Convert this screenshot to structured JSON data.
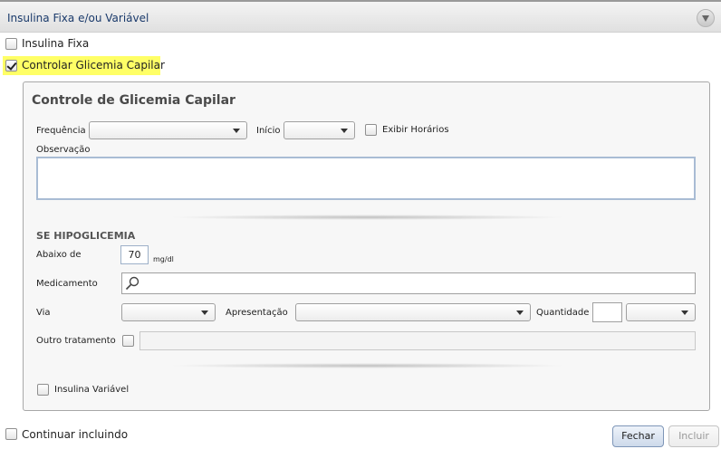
{
  "header": {
    "title": "Insulina Fixa e/ou Variável"
  },
  "options": {
    "insulina_fixa": {
      "label": "Insulina Fixa",
      "checked": false
    },
    "controlar_glicemia": {
      "label": "Controlar Glicemia Capilar",
      "checked": true
    }
  },
  "panel": {
    "title": "Controle de Glicemia Capilar",
    "frequencia_label": "Frequência",
    "frequencia_value": "",
    "inicio_label": "Início",
    "inicio_value": "",
    "exibir_horarios_label": "Exibir Horários",
    "observacao_label": "Observação",
    "observacao_value": "",
    "hipoglicemia": {
      "heading": "SE HIPOGLICEMIA",
      "abaixo_label": "Abaixo de",
      "abaixo_value": "70",
      "unit": "mg/dl",
      "medicamento_label": "Medicamento",
      "medicamento_value": "",
      "via_label": "Via",
      "via_value": "",
      "apresentacao_label": "Apresentação",
      "apresentacao_value": "",
      "quantidade_label": "Quantidade",
      "quantidade_value": "",
      "quantidade_unit_value": "",
      "outro_label": "Outro tratamento",
      "outro_value": ""
    },
    "insulina_variavel_label": "Insulina Variável"
  },
  "footer": {
    "continuar_label": "Continuar incluindo",
    "fechar_label": "Fechar",
    "incluir_label": "Incluir"
  },
  "colors": {
    "highlight": "#ffff66",
    "title_text": "#1a3a6b"
  }
}
